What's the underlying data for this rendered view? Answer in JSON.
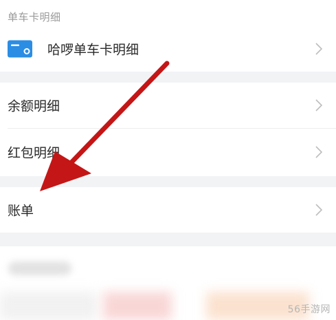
{
  "section": {
    "title": "单车卡明细"
  },
  "rows": {
    "card": {
      "label": "哈啰单车卡明细"
    },
    "balance": {
      "label": "余额明细"
    },
    "redpacket": {
      "label": "红包明细"
    },
    "bill": {
      "label": "账单"
    }
  },
  "colors": {
    "card_icon": "#2b8de4",
    "arrow": "#c41616",
    "chevron": "#bdbdbd",
    "gap": "#f2f3f5"
  },
  "icons": {
    "card": "bike-card-icon",
    "chevron": "chevron-right-icon"
  },
  "watermark": "56手游网"
}
